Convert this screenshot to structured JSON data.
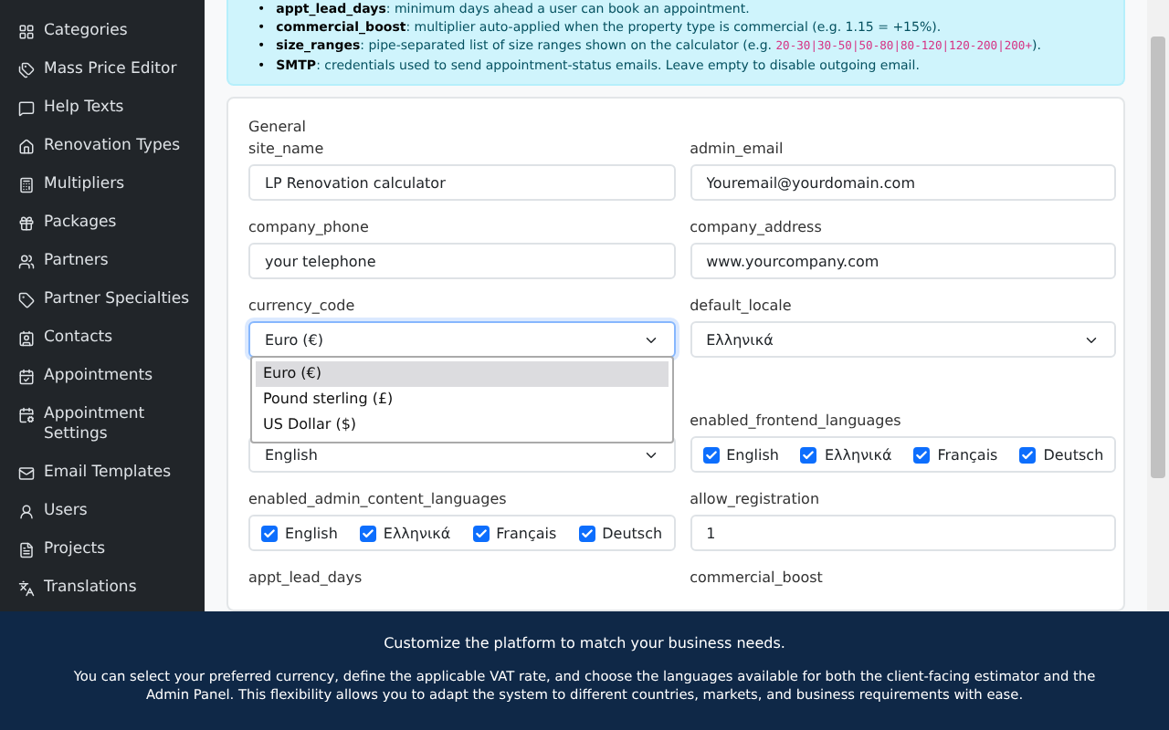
{
  "sidebar": {
    "items": [
      {
        "label": "Categories"
      },
      {
        "label": "Mass Price Editor"
      },
      {
        "label": "Help Texts"
      },
      {
        "label": "Renovation Types"
      },
      {
        "label": "Multipliers"
      },
      {
        "label": "Packages"
      },
      {
        "label": "Partners"
      },
      {
        "label": "Partner Specialties"
      },
      {
        "label": "Contacts"
      },
      {
        "label": "Appointments"
      },
      {
        "label": "Appointment Settings"
      },
      {
        "label": "Email Templates"
      },
      {
        "label": "Users"
      },
      {
        "label": "Projects"
      },
      {
        "label": "Translations"
      }
    ]
  },
  "info": {
    "items": [
      {
        "marker": "•",
        "key": "appt_lead_days",
        "text": ": minimum days ahead a user can book an appointment."
      },
      {
        "marker": "•",
        "key": "commercial_boost",
        "text": ": multiplier auto-applied when the property type is commercial (e.g. 1.15 = +15%)."
      },
      {
        "marker": "•",
        "key": "size_ranges",
        "text": ": pipe-separated list of size ranges shown on the calculator (e.g. ",
        "code": "20-30|30-50|50-80|80-120|120-200|200+",
        "after": ")."
      },
      {
        "marker": "•",
        "key": "SMTP",
        "text": ": credentials used to send appointment-status emails. Leave empty to disable outgoing email."
      }
    ]
  },
  "form": {
    "section_title": "General",
    "fields": [
      {
        "kind": "input",
        "label": "site_name",
        "value": "LP Renovation calculator"
      },
      {
        "kind": "input",
        "label": "admin_email",
        "value": "Youremail@yourdomain.com"
      },
      {
        "kind": "input",
        "label": "company_phone",
        "value": "your telephone"
      },
      {
        "kind": "input",
        "label": "company_address",
        "value": "www.yourcompany.com"
      },
      {
        "kind": "select",
        "label": "currency_code",
        "value": "Euro (€)",
        "open": true,
        "options": [
          {
            "label": "Euro (€)",
            "selected": true
          },
          {
            "label": "Pound sterling (£)",
            "selected": false
          },
          {
            "label": "US Dollar ($)",
            "selected": false
          }
        ]
      },
      {
        "kind": "select",
        "label": "default_locale",
        "value": "Ελληνικά",
        "open": false
      },
      {
        "kind": "select",
        "value": "English",
        "open": false
      },
      {
        "kind": "checkboxes",
        "label": "enabled_frontend_languages",
        "options": [
          {
            "label": "English",
            "checked": true
          },
          {
            "label": "Ελληνικά",
            "checked": true
          },
          {
            "label": "Français",
            "checked": true
          },
          {
            "label": "Deutsch",
            "checked": true
          }
        ]
      },
      {
        "kind": "checkboxes",
        "label": "enabled_admin_content_languages",
        "options": [
          {
            "label": "English",
            "checked": true
          },
          {
            "label": "Ελληνικά",
            "checked": true
          },
          {
            "label": "Français",
            "checked": true
          },
          {
            "label": "Deutsch",
            "checked": true
          }
        ]
      },
      {
        "kind": "input",
        "label": "allow_registration",
        "value": "1"
      },
      {
        "kind": "label",
        "label": "appt_lead_days"
      },
      {
        "kind": "label",
        "label": "commercial_boost"
      }
    ]
  },
  "banner": {
    "title": "Customize the platform to match your business needs.",
    "text": "You can select your preferred currency, define the applicable VAT rate, and choose the languages available for both the client-facing estimator and the Admin Panel. This flexibility allows you to adapt the system to different countries, markets, and business requirements with ease."
  }
}
